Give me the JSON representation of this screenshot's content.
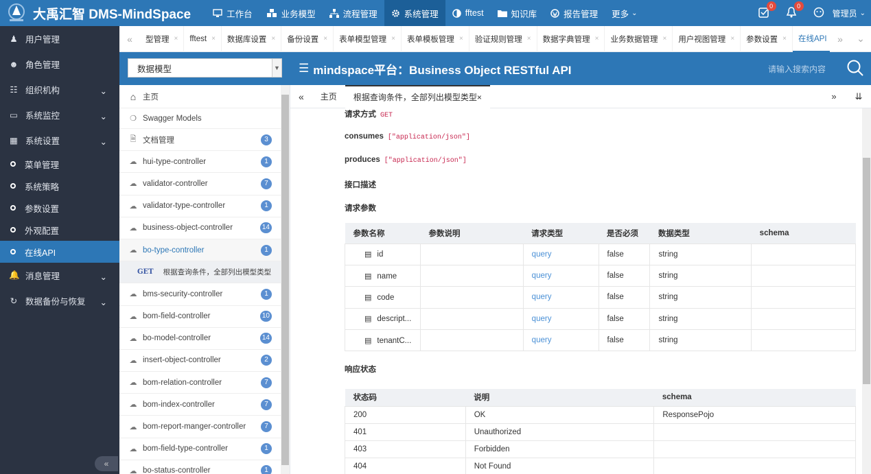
{
  "brand": {
    "name": "大禹汇智 DMS-MindSpace"
  },
  "topnav": [
    {
      "label": "工作台",
      "icon": "monitor-icon"
    },
    {
      "label": "业务模型",
      "icon": "cubes-icon"
    },
    {
      "label": "流程管理",
      "icon": "sitemap-icon"
    },
    {
      "label": "系统管理",
      "icon": "gear-icon",
      "active": true
    },
    {
      "label": "fftest",
      "icon": "contrast-icon"
    },
    {
      "label": "知识库",
      "icon": "folder-icon"
    },
    {
      "label": "报告管理",
      "icon": "wordpress-icon"
    },
    {
      "label": "更多"
    }
  ],
  "topright": {
    "task_badge": "0",
    "notify_badge": "0",
    "user": "管理员"
  },
  "sidebar": {
    "items": [
      {
        "label": "用户管理"
      },
      {
        "label": "角色管理"
      },
      {
        "label": "组织机构"
      },
      {
        "label": "系统监控"
      },
      {
        "label": "系统设置"
      }
    ],
    "subitems": [
      {
        "label": "菜单管理"
      },
      {
        "label": "系统策略"
      },
      {
        "label": "参数设置"
      },
      {
        "label": "外观配置"
      },
      {
        "label": "在线API"
      }
    ],
    "items2": [
      {
        "label": "消息管理"
      },
      {
        "label": "数据备份与恢复"
      }
    ]
  },
  "tabs": [
    {
      "label": "型管理"
    },
    {
      "label": "fftest"
    },
    {
      "label": "数据库设置"
    },
    {
      "label": "备份设置"
    },
    {
      "label": "表单模型管理"
    },
    {
      "label": "表单模板管理"
    },
    {
      "label": "验证规则管理"
    },
    {
      "label": "数据字典管理"
    },
    {
      "label": "业务数据管理"
    },
    {
      "label": "用户视图管理"
    },
    {
      "label": "参数设置"
    },
    {
      "label": "在线API"
    }
  ],
  "selector": {
    "value": "数据模型"
  },
  "apibar": {
    "title": "mindspace平台：Business Object RESTful API",
    "search_placeholder": "请输入搜索内容"
  },
  "tree": {
    "home": "主页",
    "swagger": "Swagger Models",
    "items": [
      {
        "label": "文档管理",
        "count": "3"
      },
      {
        "label": "hui-type-controller",
        "count": "1"
      },
      {
        "label": "validator-controller",
        "count": "7"
      },
      {
        "label": "validator-type-controller",
        "count": "1"
      },
      {
        "label": "business-object-controller",
        "count": "14"
      },
      {
        "label": "bo-type-controller",
        "count": "1"
      }
    ],
    "op": {
      "method": "GET",
      "label": "根据查询条件，全部列出模型类型"
    },
    "items2": [
      {
        "label": "bms-security-controller",
        "count": "1"
      },
      {
        "label": "bom-field-controller",
        "count": "10"
      },
      {
        "label": "bo-model-controller",
        "count": "14"
      },
      {
        "label": "insert-object-controller",
        "count": "2"
      },
      {
        "label": "bom-relation-controller",
        "count": "7"
      },
      {
        "label": "bom-index-controller",
        "count": "7"
      },
      {
        "label": "bom-report-manger-controller",
        "count": "7"
      },
      {
        "label": "bom-field-type-controller",
        "count": "1"
      },
      {
        "label": "bo-status-controller",
        "count": "1"
      }
    ]
  },
  "doctabs": {
    "home": "主页",
    "active": "根据查询条件，全部列出模型类型×"
  },
  "doc": {
    "method_label": "请求方式",
    "method": "GET",
    "consumes_label": "consumes",
    "consumes": "[\"application/json\"]",
    "produces_label": "produces",
    "produces": "[\"application/json\"]",
    "desc_label": "接口描述",
    "params_label": "请求参数",
    "params_headers": [
      "参数名称",
      "参数说明",
      "请求类型",
      "是否必须",
      "数据类型",
      "schema"
    ],
    "params": [
      {
        "name": "id",
        "desc": "",
        "in": "query",
        "required": "false",
        "type": "string"
      },
      {
        "name": "name",
        "desc": "",
        "in": "query",
        "required": "false",
        "type": "string"
      },
      {
        "name": "code",
        "desc": "",
        "in": "query",
        "required": "false",
        "type": "string"
      },
      {
        "name": "descript...",
        "desc": "",
        "in": "query",
        "required": "false",
        "type": "string"
      },
      {
        "name": "tenantC...",
        "desc": "",
        "in": "query",
        "required": "false",
        "type": "string"
      }
    ],
    "resp_label": "响应状态",
    "resp_headers": [
      "状态码",
      "说明",
      "schema"
    ],
    "resp": [
      {
        "code": "200",
        "desc": "OK",
        "schema": "ResponsePojo"
      },
      {
        "code": "401",
        "desc": "Unauthorized",
        "schema": ""
      },
      {
        "code": "403",
        "desc": "Forbidden",
        "schema": ""
      },
      {
        "code": "404",
        "desc": "Not Found",
        "schema": ""
      }
    ]
  }
}
